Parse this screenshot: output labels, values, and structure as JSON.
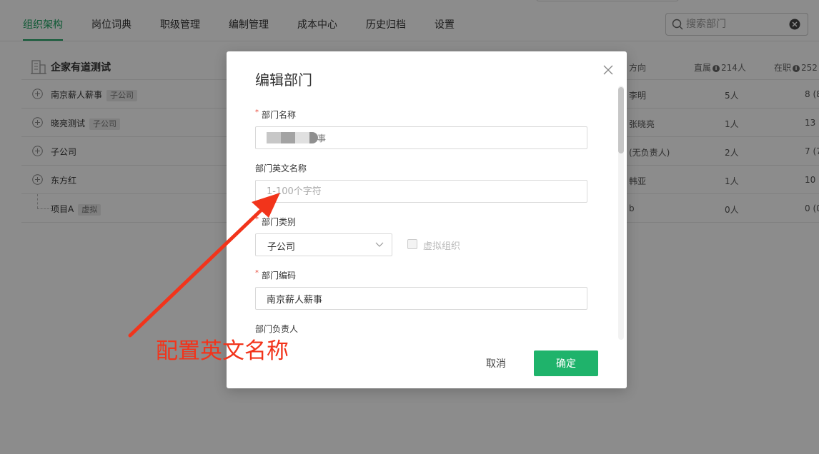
{
  "nav": {
    "tabs": [
      {
        "label": "组织架构",
        "active": true
      },
      {
        "label": "岗位词典"
      },
      {
        "label": "职级管理"
      },
      {
        "label": "编制管理"
      },
      {
        "label": "成本中心"
      },
      {
        "label": "历史归档"
      },
      {
        "label": "设置"
      }
    ],
    "search_placeholder": "搜索部门"
  },
  "org_tree": {
    "root_name": "企家有道测试",
    "columns": {
      "direction": "方向",
      "direct_label": "直属",
      "direct_count": "214人",
      "onjob_label": "在职",
      "onjob_count": "252"
    },
    "rows": [
      {
        "name": "南京薪人薪事",
        "tag": "子公司",
        "head": "李明",
        "direct": "5人",
        "onjob": "8 (8"
      },
      {
        "name": "晓亮测试",
        "tag": "子公司",
        "head": "张晓亮",
        "direct": "1人",
        "onjob": "13 ("
      },
      {
        "name": "子公司",
        "tag": "",
        "head": "(无负责人)",
        "direct": "2人",
        "onjob": "7 (7"
      },
      {
        "name": "东方红",
        "tag": "",
        "head": "韩亚",
        "direct": "1人",
        "onjob": "10 ("
      },
      {
        "name": "项目A",
        "tag": "虚拟",
        "head": "b",
        "direct": "0人",
        "onjob": "0 (0"
      }
    ]
  },
  "modal": {
    "title": "编辑部门",
    "fields": {
      "dept_name_label": "部门名称",
      "dept_name_partial": "事",
      "dept_en_label": "部门英文名称",
      "dept_en_placeholder": "1-100个字符",
      "dept_type_label": "部门类别",
      "dept_type_value": "子公司",
      "virtual_org_label": "虚拟组织",
      "dept_code_label": "部门编码",
      "dept_code_value": "南京薪人薪事",
      "dept_head_label": "部门负责人"
    },
    "cancel_label": "取消",
    "ok_label": "确定"
  },
  "annotation": {
    "text": "配置英文名称",
    "color": "#f2341b"
  },
  "colors": {
    "accent": "#19a15f",
    "primary_button": "#1fb36b",
    "required": "#e84b3b"
  }
}
